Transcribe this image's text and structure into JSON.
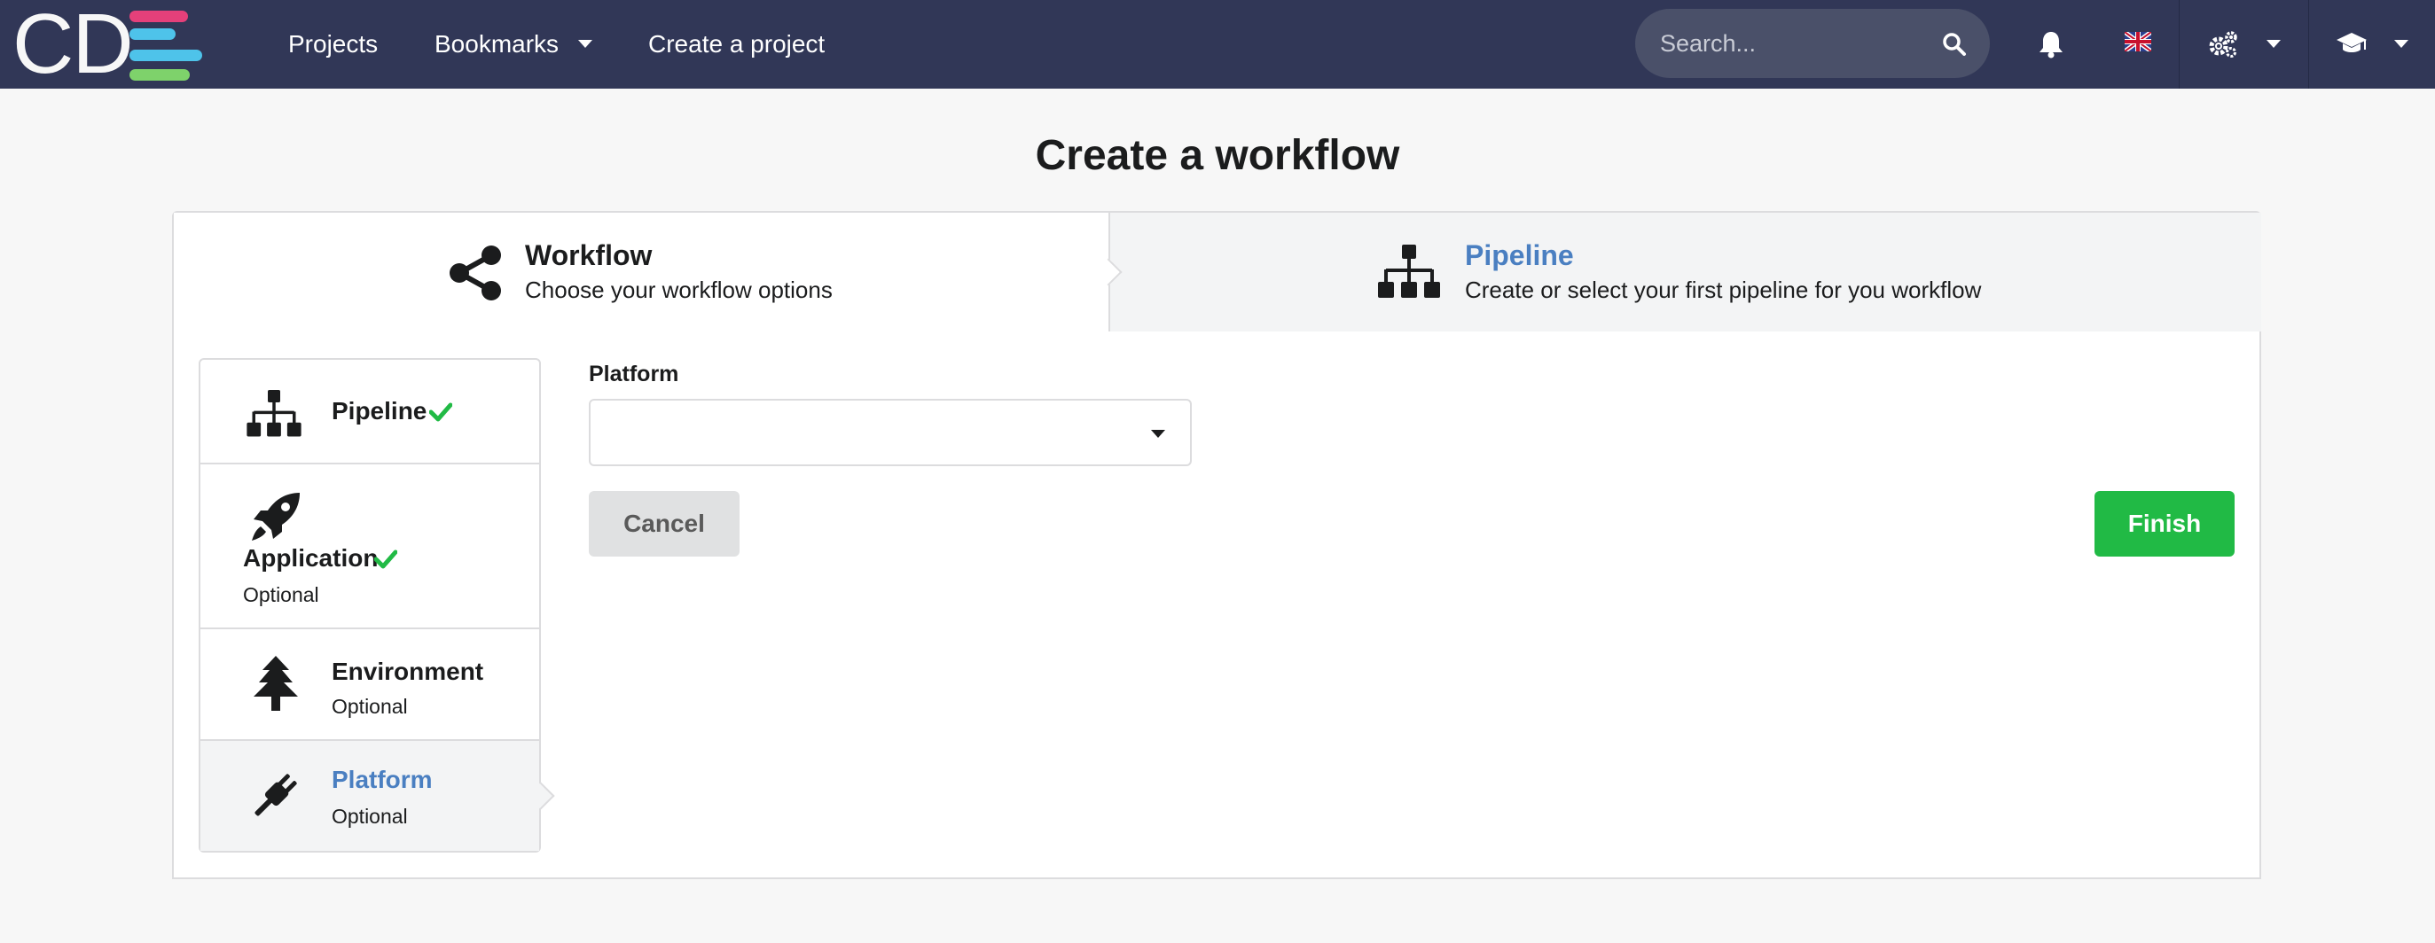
{
  "colors": {
    "navbar_bg": "#313757",
    "accent_blue": "#4a7fc1",
    "success_green": "#21ba45",
    "check_green": "#21ba45",
    "logo_pink": "#e5407a",
    "logo_cyan": "#4ec3ea",
    "logo_green": "#7ed26b"
  },
  "navbar": {
    "logo_text": "CD",
    "items": [
      {
        "label": "Projects"
      },
      {
        "label": "Bookmarks"
      },
      {
        "label": "Create a project"
      }
    ],
    "search": {
      "placeholder": "Search...",
      "value": ""
    },
    "icons": [
      "search-icon",
      "bell-icon",
      "flag-uk-icon",
      "cogs-icon",
      "graduation-cap-icon"
    ]
  },
  "page": {
    "title": "Create a workflow"
  },
  "steps": [
    {
      "title": "Workflow",
      "description": "Choose your workflow options",
      "icon": "share-alt-icon",
      "active": true
    },
    {
      "title": "Pipeline",
      "description": "Create or select your first pipeline for you workflow",
      "icon": "sitemap-icon",
      "active": false
    }
  ],
  "menu": {
    "items": [
      {
        "label": "Pipeline",
        "sub": "",
        "icon": "sitemap-icon",
        "checked": true
      },
      {
        "label": "Application",
        "sub": "Optional",
        "icon": "rocket-icon",
        "checked": true
      },
      {
        "label": "Environment",
        "sub": "Optional",
        "icon": "tree-icon",
        "checked": false
      },
      {
        "label": "Platform",
        "sub": "Optional",
        "icon": "plug-icon",
        "checked": false,
        "active": true
      }
    ]
  },
  "form": {
    "platform_label": "Platform",
    "platform_value": "",
    "cancel_label": "Cancel",
    "finish_label": "Finish"
  }
}
